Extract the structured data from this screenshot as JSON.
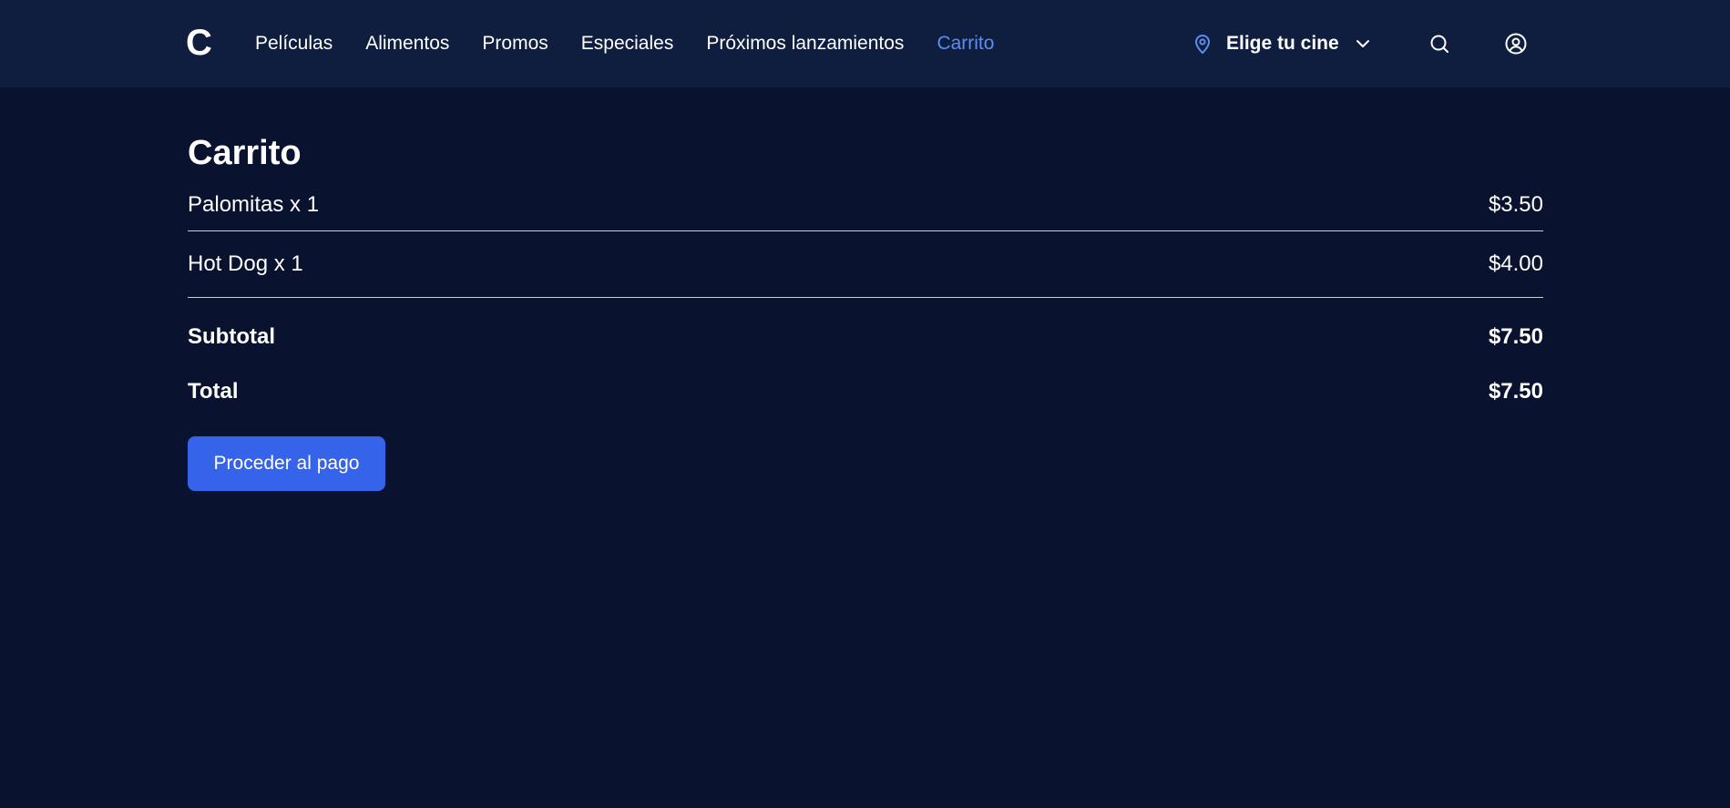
{
  "header": {
    "logo": "C",
    "nav": [
      {
        "label": "Películas",
        "active": false
      },
      {
        "label": "Alimentos",
        "active": false
      },
      {
        "label": "Promos",
        "active": false
      },
      {
        "label": "Especiales",
        "active": false
      },
      {
        "label": "Próximos lanzamientos",
        "active": false
      },
      {
        "label": "Carrito",
        "active": true
      }
    ],
    "cinema_picker": {
      "label": "Elige tu cine",
      "icon": "location-pin-icon",
      "dropdown_icon": "chevron-down-icon"
    },
    "search_icon": "search-icon",
    "account_icon": "user-circle-icon"
  },
  "cart": {
    "title": "Carrito",
    "items": [
      {
        "name": "Palomitas x 1",
        "price": "$3.50"
      },
      {
        "name": "Hot Dog x 1",
        "price": "$4.00"
      }
    ],
    "subtotal_label": "Subtotal",
    "subtotal_value": "$7.50",
    "total_label": "Total",
    "total_value": "$7.50",
    "checkout_label": "Proceder al pago"
  },
  "colors": {
    "page_background": "#091330",
    "header_background": "#0f1d3f",
    "active_nav": "#5b8ef0",
    "primary_button": "#3563e9",
    "text": "#ffffff"
  }
}
